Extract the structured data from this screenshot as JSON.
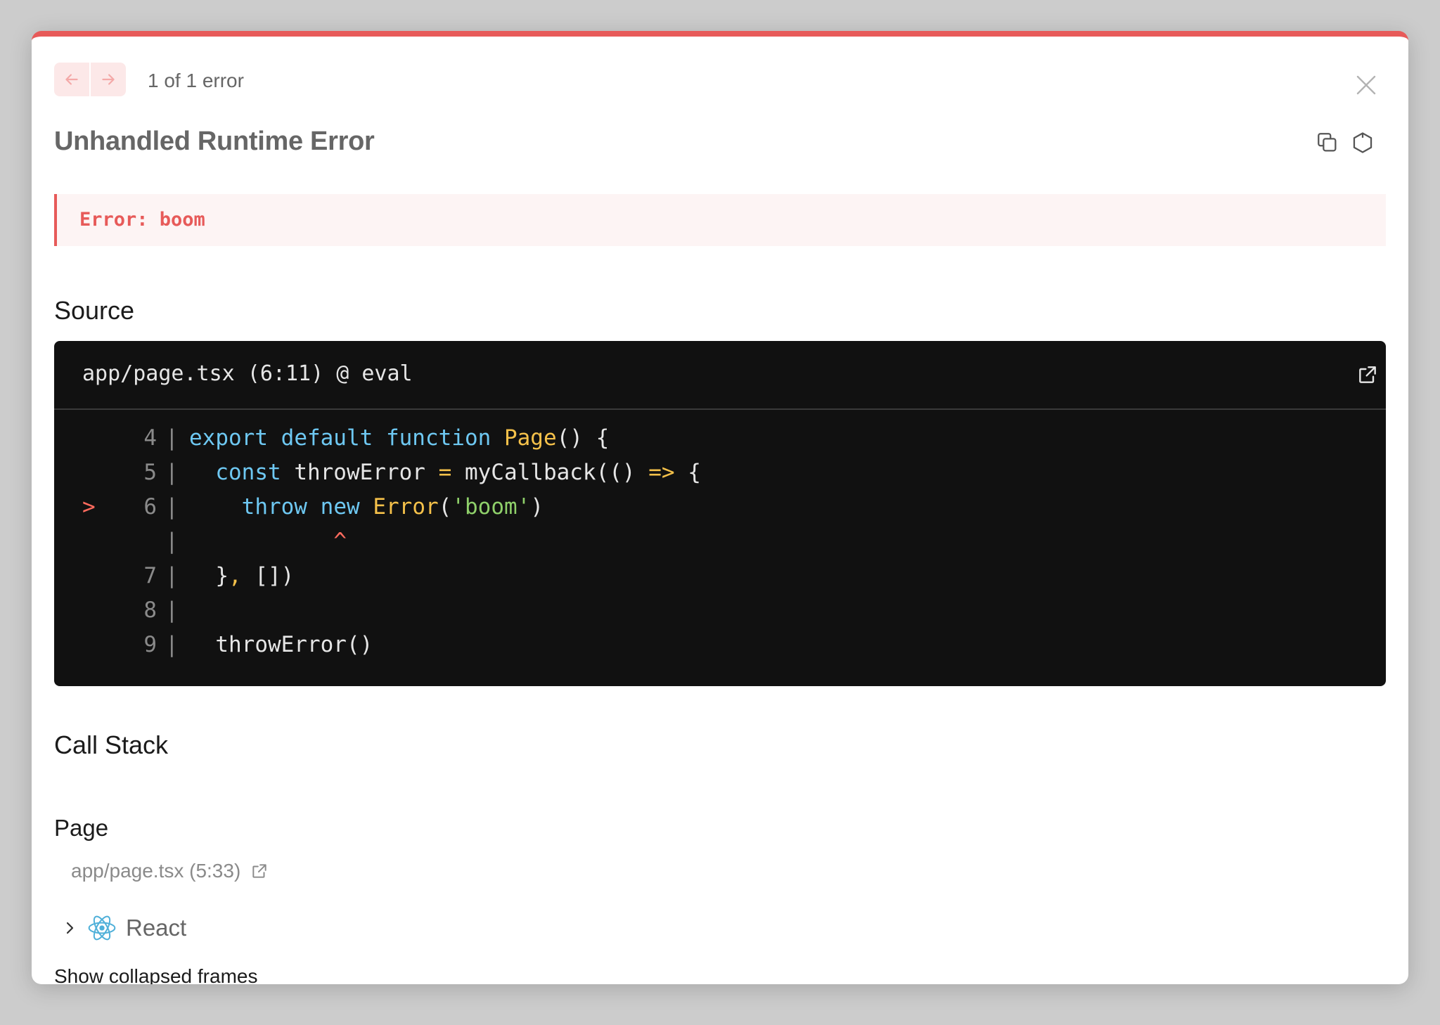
{
  "header": {
    "error_counter": "1 of 1 error",
    "title": "Unhandled Runtime Error"
  },
  "error": {
    "message": "Error: boom"
  },
  "source": {
    "heading": "Source",
    "file_location": "app/page.tsx (6:11) @ eval",
    "lines": [
      {
        "marker": "",
        "num": "4",
        "sep": "|",
        "code": "export default function Page() {"
      },
      {
        "marker": "",
        "num": "5",
        "sep": "|",
        "code": "  const throwError = myCallback(() => {"
      },
      {
        "marker": ">",
        "num": "6",
        "sep": "|",
        "code": "    throw new Error('boom')"
      },
      {
        "marker": "",
        "num": "",
        "sep": "|",
        "code": "           ^"
      },
      {
        "marker": "",
        "num": "7",
        "sep": "|",
        "code": "  }, [])"
      },
      {
        "marker": "",
        "num": "8",
        "sep": "|",
        "code": ""
      },
      {
        "marker": "",
        "num": "9",
        "sep": "|",
        "code": "  throwError()"
      }
    ]
  },
  "call_stack": {
    "heading": "Call Stack",
    "frame_name": "Page",
    "frame_location": "app/page.tsx (5:33)",
    "group_label": "React",
    "show_collapsed_label": "Show collapsed frames"
  },
  "icons": {
    "prev": "arrow-left-icon",
    "next": "arrow-right-icon",
    "close": "close-icon",
    "copy": "copy-icon",
    "hexagon": "hexagon-icon",
    "open_in_editor": "external-link-icon",
    "chevron": "chevron-right-icon",
    "react": "react-logo-icon"
  },
  "colors": {
    "accent_red": "#e75a59",
    "code_background": "#111111",
    "keyword": "#6ec8f2",
    "function": "#f5c14a",
    "string": "#8fd06a"
  }
}
